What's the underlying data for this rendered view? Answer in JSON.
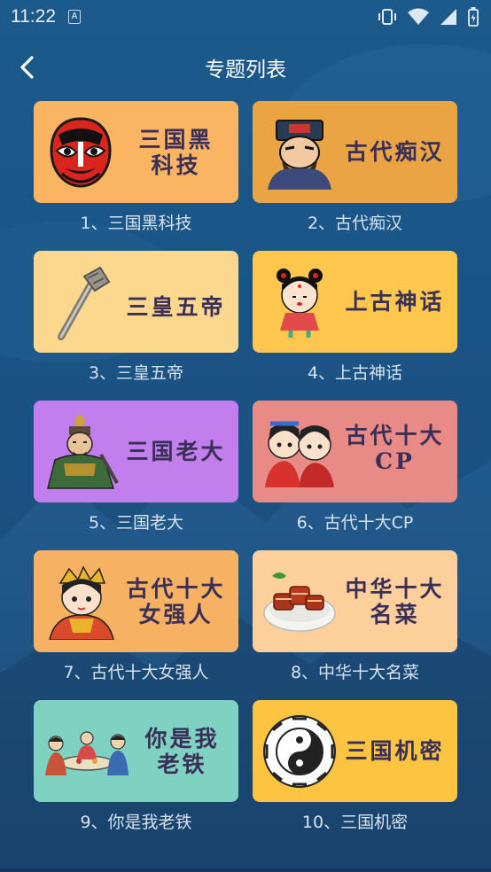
{
  "status_bar": {
    "time": "11:22",
    "notification_letter": "A",
    "icons": [
      "vibrate-icon",
      "wifi-icon",
      "signal-icon",
      "battery-icon"
    ]
  },
  "header": {
    "title": "专题列表",
    "back_icon": "chevron-left-icon"
  },
  "colors": {
    "background": "#1a5486",
    "text_on_card": "#3a2f57",
    "caption": "#d6e2ee"
  },
  "topics": [
    {
      "card_line1": "三国黑",
      "card_line2": "科技",
      "caption": "1、三国黑科技",
      "color": "#fbb462",
      "icon": "opera-mask-icon"
    },
    {
      "card_line1": "古代痴汉",
      "card_line2": "",
      "caption": "2、古代痴汉",
      "color": "#eaa444",
      "icon": "official-figure-icon"
    },
    {
      "card_line1": "三皇五帝",
      "card_line2": "",
      "caption": "3、三皇五帝",
      "color": "#fcd88e",
      "icon": "scepter-icon"
    },
    {
      "card_line1": "上古神话",
      "card_line2": "",
      "caption": "4、上古神话",
      "color": "#fdc64c",
      "icon": "myth-girl-icon"
    },
    {
      "card_line1": "三国老大",
      "card_line2": "",
      "caption": "5、三国老大",
      "color": "#c17eec",
      "icon": "warlord-icon"
    },
    {
      "card_line1": "古代十大",
      "card_line2": "CP",
      "caption": "6、古代十大CP",
      "color": "#e88a86",
      "icon": "couple-icon"
    },
    {
      "card_line1": "古代十大",
      "card_line2": "女强人",
      "caption": "7、古代十大女强人",
      "color": "#f6b262",
      "icon": "empress-icon"
    },
    {
      "card_line1": "中华十大",
      "card_line2": "名菜",
      "caption": "8、中华十大名菜",
      "color": "#fdd09b",
      "icon": "braised-pork-icon"
    },
    {
      "card_line1": "你是我",
      "card_line2": "老铁",
      "caption": "9、你是我老铁",
      "color": "#7fd2c2",
      "icon": "banquet-icon"
    },
    {
      "card_line1": "三国机密",
      "card_line2": "",
      "caption": "10、三国机密",
      "color": "#fdc442",
      "icon": "yin-yang-icon"
    }
  ]
}
